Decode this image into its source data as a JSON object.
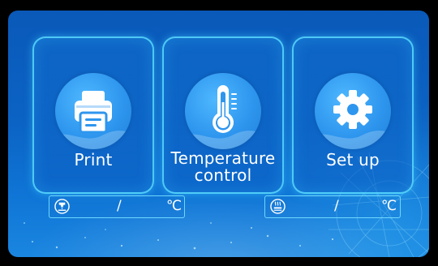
{
  "menu": {
    "print_label": "Print",
    "temperature_label_line1": "Temperature",
    "temperature_label_line2": "control",
    "setup_label": "Set up"
  },
  "status": {
    "nozzle": {
      "icon": "nozzle-icon",
      "separator": "/",
      "unit": "℃"
    },
    "bed": {
      "icon": "heated-bed-icon",
      "separator": "/",
      "unit": "℃"
    }
  },
  "colors": {
    "accent": "#5adcff",
    "background": "#0b63c4",
    "icon_circle": "#2e96ee"
  }
}
